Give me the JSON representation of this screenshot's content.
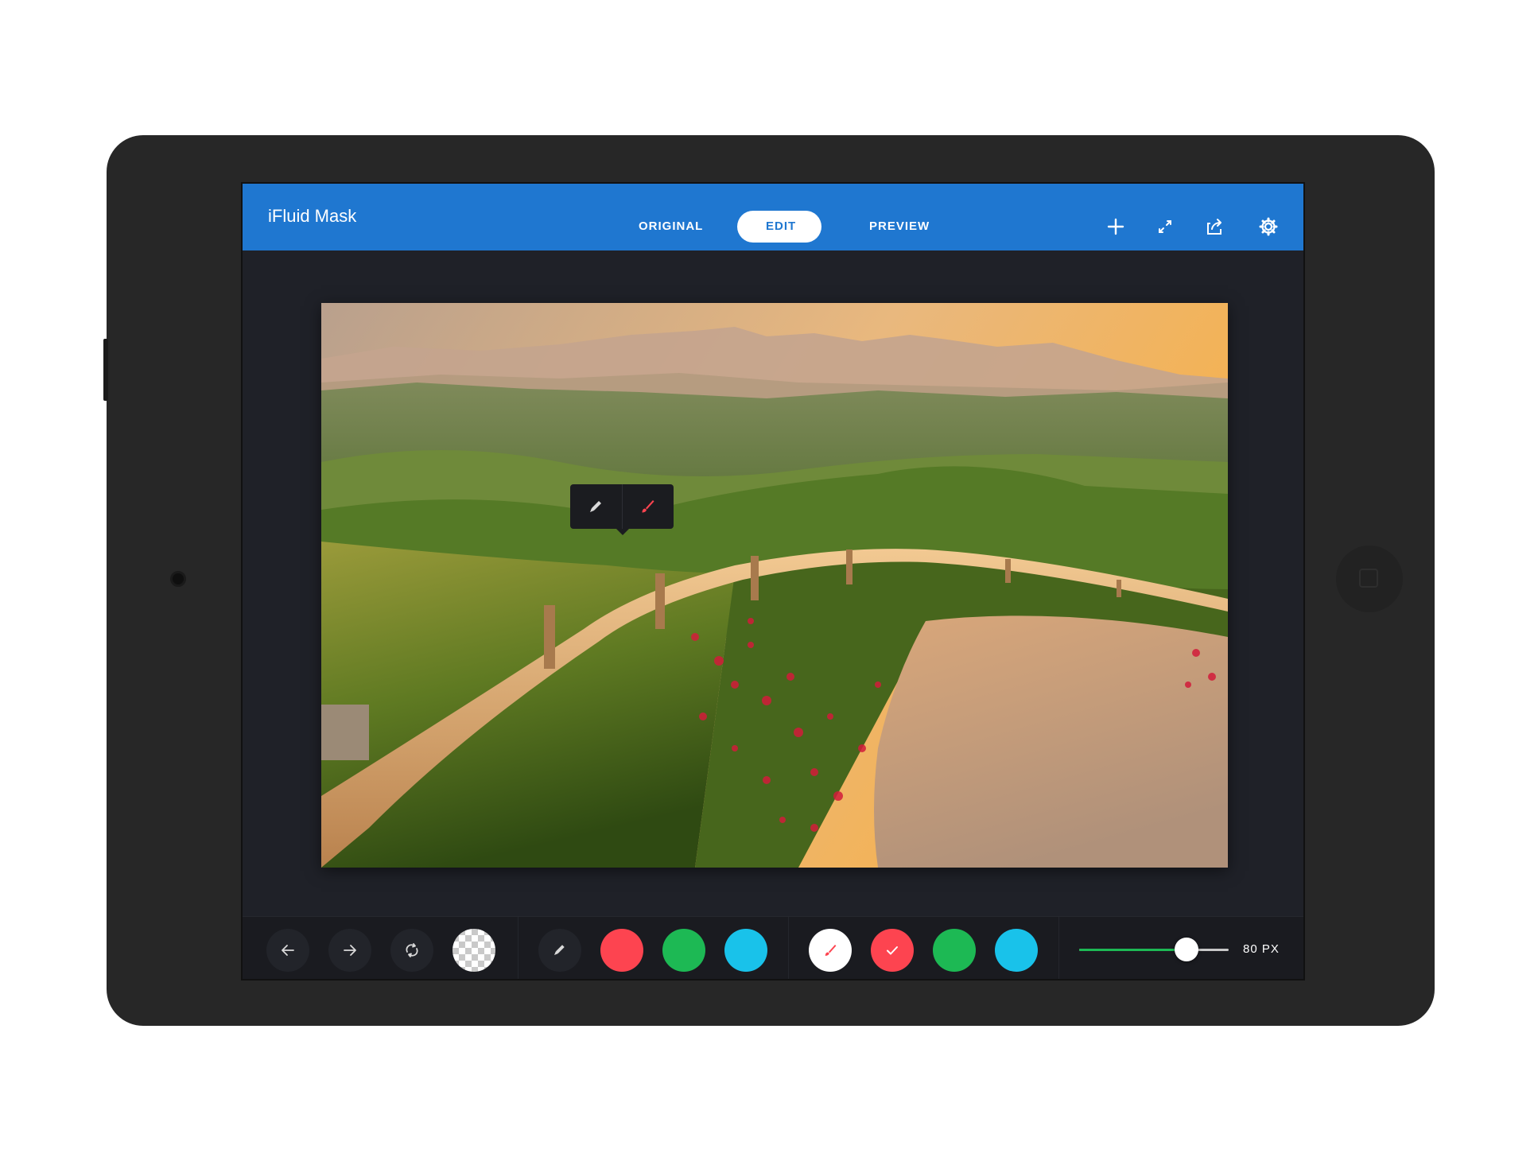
{
  "app": {
    "title": "iFluid Mask"
  },
  "tabs": [
    {
      "label": "ORIGINAL",
      "active": false
    },
    {
      "label": "EDIT",
      "active": true
    },
    {
      "label": "PREVIEW",
      "active": false
    }
  ],
  "header_icons": [
    "plus-icon",
    "fullscreen-icon",
    "share-icon",
    "gear-icon"
  ],
  "popover": {
    "tools": [
      "pencil-icon",
      "brush-icon"
    ],
    "active_tool": "brush-icon"
  },
  "toolbar": {
    "history_icons": [
      "arrow-left-icon",
      "arrow-right-icon",
      "refresh-icon"
    ],
    "transparency": "checkerboard-swatch",
    "pencil_colors": [
      "#fd4450",
      "#1db954",
      "#19c2ea"
    ],
    "brush_colors": [
      "#fd4450",
      "#1db954",
      "#19c2ea"
    ],
    "brush_selected_color": "#fd4450",
    "brush_size": {
      "value": 80,
      "max_fraction": 0.72,
      "label": "80 PX"
    }
  },
  "colors": {
    "header": "#1f77d0",
    "screen_bg": "#1f2128",
    "accent_red": "#fd4450",
    "accent_green": "#1db954",
    "accent_cyan": "#19c2ea"
  }
}
